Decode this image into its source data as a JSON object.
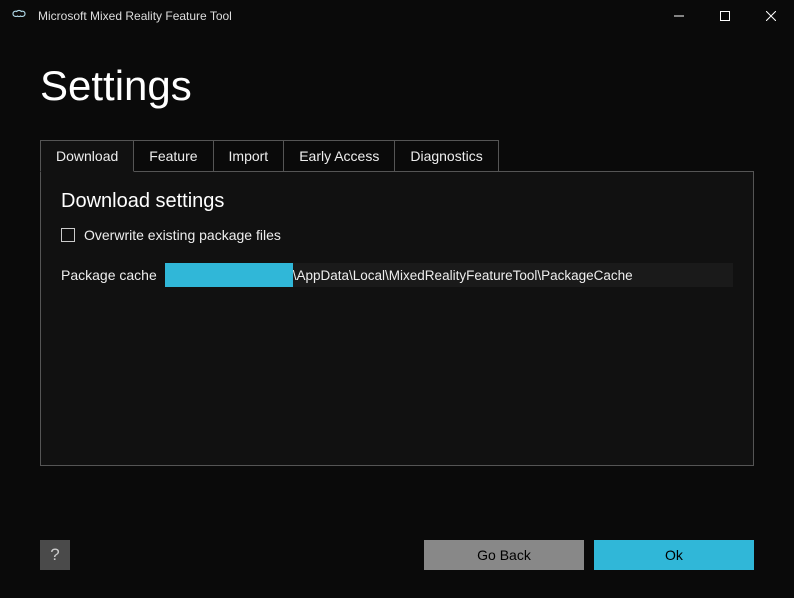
{
  "titlebar": {
    "title": "Microsoft Mixed Reality Feature Tool"
  },
  "page": {
    "title": "Settings"
  },
  "tabs": [
    {
      "label": "Download",
      "active": true
    },
    {
      "label": "Feature",
      "active": false
    },
    {
      "label": "Import",
      "active": false
    },
    {
      "label": "Early Access",
      "active": false
    },
    {
      "label": "Diagnostics",
      "active": false
    }
  ],
  "panel": {
    "section_title": "Download settings",
    "overwrite_checkbox": {
      "label": "Overwrite existing package files",
      "checked": false
    },
    "package_cache": {
      "label": "Package cache",
      "path_visible": "\\AppData\\Local\\MixedRealityFeatureTool\\PackageCache"
    }
  },
  "footer": {
    "help_label": "?",
    "go_back_label": "Go Back",
    "ok_label": "Ok"
  }
}
